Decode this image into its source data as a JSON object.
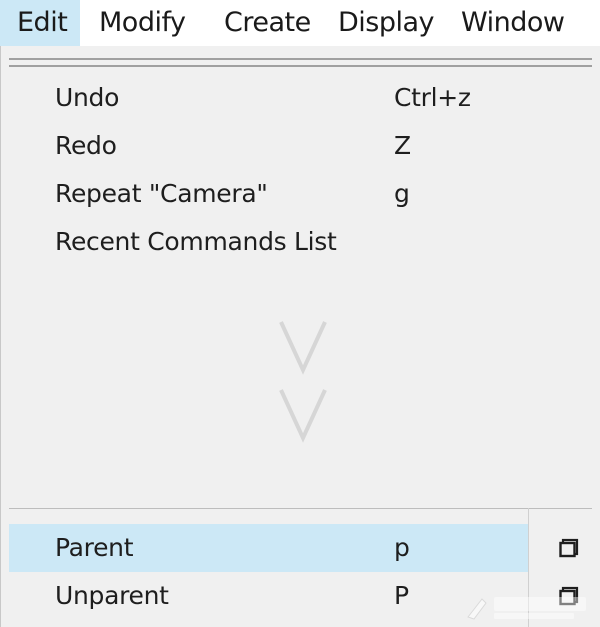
{
  "menubar": {
    "items": [
      {
        "label": "Edit",
        "active": true
      },
      {
        "label": "Modify",
        "active": false
      },
      {
        "label": "Create",
        "active": false
      },
      {
        "label": "Display",
        "active": false
      },
      {
        "label": "Window",
        "active": false
      }
    ]
  },
  "menu": {
    "top_items": [
      {
        "label": "Undo",
        "shortcut": "Ctrl+z"
      },
      {
        "label": "Redo",
        "shortcut": "Z"
      },
      {
        "label": "Repeat \"Camera\"",
        "shortcut": "g"
      },
      {
        "label": "Recent Commands List",
        "shortcut": ""
      }
    ],
    "more_indicator_icon": "chevron-down-double-icon",
    "bottom_items": [
      {
        "label": "Parent",
        "shortcut": "p",
        "highlighted": true,
        "option_icon": "option-box-icon"
      },
      {
        "label": "Unparent",
        "shortcut": "P",
        "highlighted": false,
        "option_icon": "option-box-icon"
      }
    ]
  },
  "colors": {
    "highlight": "#cce8f6",
    "menu_bg": "#f0f0f0",
    "menubar_bg": "#ffffff",
    "text": "#1e1e1e"
  }
}
